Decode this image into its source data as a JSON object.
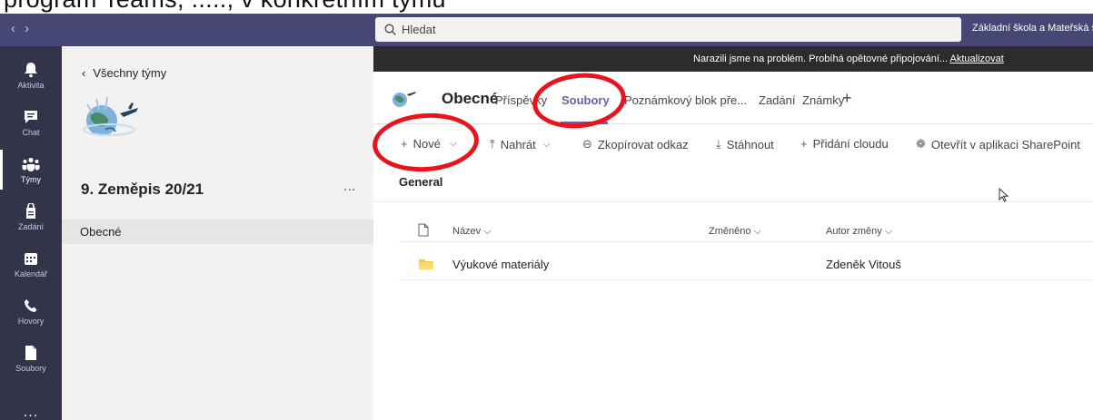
{
  "caption": "program Teams, ....., v konkrétním týmu",
  "titlebar": {
    "search_placeholder": "Hledat",
    "org": "Základní škola a Mateřská š"
  },
  "rail": [
    {
      "label": "Aktivita",
      "icon": "bell-icon"
    },
    {
      "label": "Chat",
      "icon": "chat-icon"
    },
    {
      "label": "Týmy",
      "icon": "teams-icon",
      "active": true
    },
    {
      "label": "Zadání",
      "icon": "assignments-icon"
    },
    {
      "label": "Kalendář",
      "icon": "calendar-icon"
    },
    {
      "label": "Hovory",
      "icon": "phone-icon"
    },
    {
      "label": "Soubory",
      "icon": "file-icon"
    }
  ],
  "rail_more": "...",
  "team": {
    "back": "Všechny týmy",
    "name": "9. Zeměpis 20/21",
    "more": "...",
    "channel": "Obecné"
  },
  "banner": {
    "text": "Narazili jsme na problém. Probíhá opětovné připojování...",
    "link": "Aktualizovat"
  },
  "channel": {
    "title": "Obecné",
    "tabs": [
      "Příspěvky",
      "Soubory",
      "Poznámkový blok pře...",
      "Zadání",
      "Známky"
    ],
    "active_tab": "Soubory",
    "add_tab": "+"
  },
  "toolbar": {
    "new": "Nové",
    "upload": "Nahrát",
    "copy_link": "Zkopírovat odkaz",
    "download": "Stáhnout",
    "add_cloud": "Přidání cloudu",
    "open_sharepoint": "Otevřít v aplikaci SharePoint"
  },
  "files": {
    "folder": "General",
    "columns": {
      "name": "Název",
      "modified": "Změněno",
      "author": "Autor změny"
    },
    "rows": [
      {
        "name": "Výukové materiály",
        "modified": "",
        "author": "Zdeněk Vitouš"
      }
    ]
  },
  "colors": {
    "brand": "#6264a7",
    "rail": "#33344a",
    "titlebar": "#464775",
    "highlight": "#e8131b"
  }
}
